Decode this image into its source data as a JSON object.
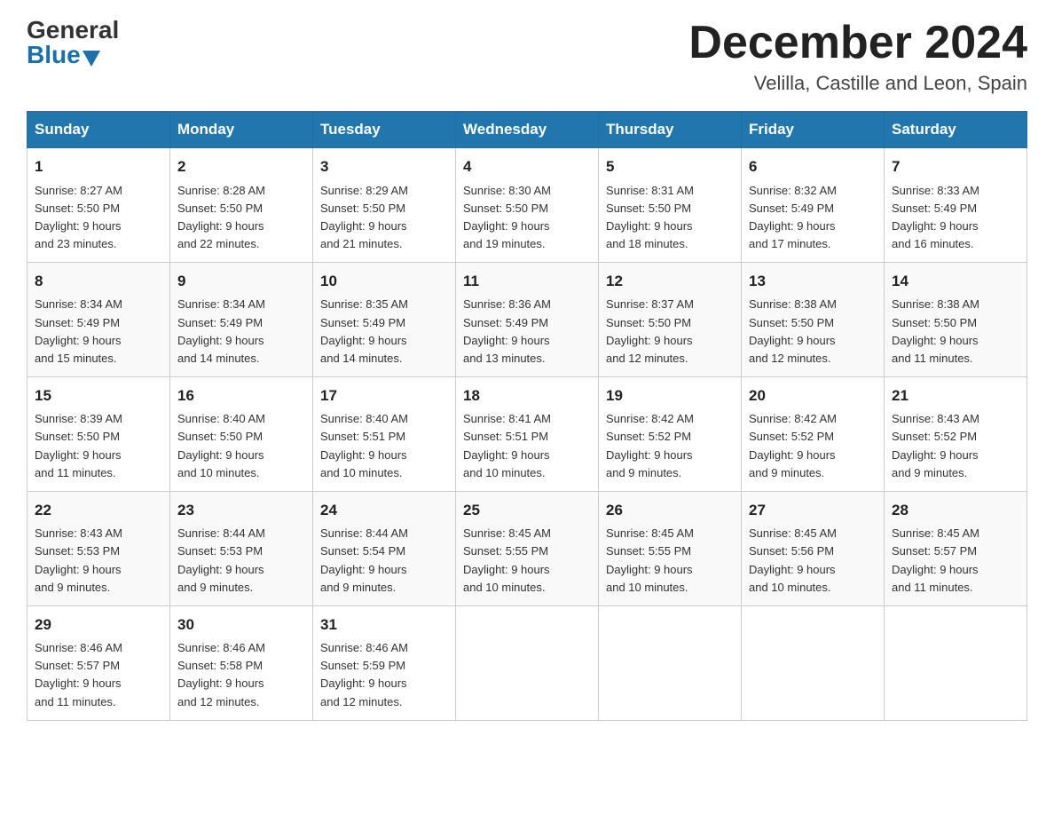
{
  "logo": {
    "general": "General",
    "blue": "Blue"
  },
  "header": {
    "month_year": "December 2024",
    "location": "Velilla, Castille and Leon, Spain"
  },
  "weekdays": [
    "Sunday",
    "Monday",
    "Tuesday",
    "Wednesday",
    "Thursday",
    "Friday",
    "Saturday"
  ],
  "weeks": [
    [
      {
        "day": "1",
        "sunrise": "8:27 AM",
        "sunset": "5:50 PM",
        "daylight": "9 hours and 23 minutes."
      },
      {
        "day": "2",
        "sunrise": "8:28 AM",
        "sunset": "5:50 PM",
        "daylight": "9 hours and 22 minutes."
      },
      {
        "day": "3",
        "sunrise": "8:29 AM",
        "sunset": "5:50 PM",
        "daylight": "9 hours and 21 minutes."
      },
      {
        "day": "4",
        "sunrise": "8:30 AM",
        "sunset": "5:50 PM",
        "daylight": "9 hours and 19 minutes."
      },
      {
        "day": "5",
        "sunrise": "8:31 AM",
        "sunset": "5:50 PM",
        "daylight": "9 hours and 18 minutes."
      },
      {
        "day": "6",
        "sunrise": "8:32 AM",
        "sunset": "5:49 PM",
        "daylight": "9 hours and 17 minutes."
      },
      {
        "day": "7",
        "sunrise": "8:33 AM",
        "sunset": "5:49 PM",
        "daylight": "9 hours and 16 minutes."
      }
    ],
    [
      {
        "day": "8",
        "sunrise": "8:34 AM",
        "sunset": "5:49 PM",
        "daylight": "9 hours and 15 minutes."
      },
      {
        "day": "9",
        "sunrise": "8:34 AM",
        "sunset": "5:49 PM",
        "daylight": "9 hours and 14 minutes."
      },
      {
        "day": "10",
        "sunrise": "8:35 AM",
        "sunset": "5:49 PM",
        "daylight": "9 hours and 14 minutes."
      },
      {
        "day": "11",
        "sunrise": "8:36 AM",
        "sunset": "5:49 PM",
        "daylight": "9 hours and 13 minutes."
      },
      {
        "day": "12",
        "sunrise": "8:37 AM",
        "sunset": "5:50 PM",
        "daylight": "9 hours and 12 minutes."
      },
      {
        "day": "13",
        "sunrise": "8:38 AM",
        "sunset": "5:50 PM",
        "daylight": "9 hours and 12 minutes."
      },
      {
        "day": "14",
        "sunrise": "8:38 AM",
        "sunset": "5:50 PM",
        "daylight": "9 hours and 11 minutes."
      }
    ],
    [
      {
        "day": "15",
        "sunrise": "8:39 AM",
        "sunset": "5:50 PM",
        "daylight": "9 hours and 11 minutes."
      },
      {
        "day": "16",
        "sunrise": "8:40 AM",
        "sunset": "5:50 PM",
        "daylight": "9 hours and 10 minutes."
      },
      {
        "day": "17",
        "sunrise": "8:40 AM",
        "sunset": "5:51 PM",
        "daylight": "9 hours and 10 minutes."
      },
      {
        "day": "18",
        "sunrise": "8:41 AM",
        "sunset": "5:51 PM",
        "daylight": "9 hours and 10 minutes."
      },
      {
        "day": "19",
        "sunrise": "8:42 AM",
        "sunset": "5:52 PM",
        "daylight": "9 hours and 9 minutes."
      },
      {
        "day": "20",
        "sunrise": "8:42 AM",
        "sunset": "5:52 PM",
        "daylight": "9 hours and 9 minutes."
      },
      {
        "day": "21",
        "sunrise": "8:43 AM",
        "sunset": "5:52 PM",
        "daylight": "9 hours and 9 minutes."
      }
    ],
    [
      {
        "day": "22",
        "sunrise": "8:43 AM",
        "sunset": "5:53 PM",
        "daylight": "9 hours and 9 minutes."
      },
      {
        "day": "23",
        "sunrise": "8:44 AM",
        "sunset": "5:53 PM",
        "daylight": "9 hours and 9 minutes."
      },
      {
        "day": "24",
        "sunrise": "8:44 AM",
        "sunset": "5:54 PM",
        "daylight": "9 hours and 9 minutes."
      },
      {
        "day": "25",
        "sunrise": "8:45 AM",
        "sunset": "5:55 PM",
        "daylight": "9 hours and 10 minutes."
      },
      {
        "day": "26",
        "sunrise": "8:45 AM",
        "sunset": "5:55 PM",
        "daylight": "9 hours and 10 minutes."
      },
      {
        "day": "27",
        "sunrise": "8:45 AM",
        "sunset": "5:56 PM",
        "daylight": "9 hours and 10 minutes."
      },
      {
        "day": "28",
        "sunrise": "8:45 AM",
        "sunset": "5:57 PM",
        "daylight": "9 hours and 11 minutes."
      }
    ],
    [
      {
        "day": "29",
        "sunrise": "8:46 AM",
        "sunset": "5:57 PM",
        "daylight": "9 hours and 11 minutes."
      },
      {
        "day": "30",
        "sunrise": "8:46 AM",
        "sunset": "5:58 PM",
        "daylight": "9 hours and 12 minutes."
      },
      {
        "day": "31",
        "sunrise": "8:46 AM",
        "sunset": "5:59 PM",
        "daylight": "9 hours and 12 minutes."
      },
      null,
      null,
      null,
      null
    ]
  ],
  "labels": {
    "sunrise": "Sunrise:",
    "sunset": "Sunset:",
    "daylight": "Daylight:"
  }
}
